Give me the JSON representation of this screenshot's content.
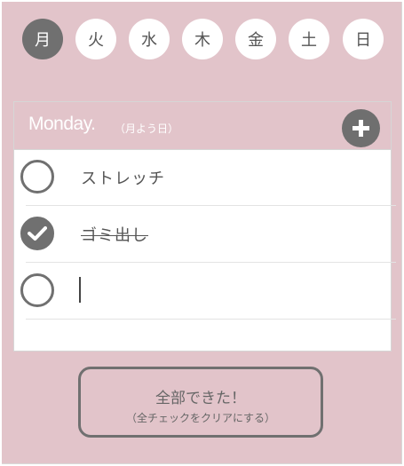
{
  "days": [
    "月",
    "火",
    "水",
    "木",
    "金",
    "土",
    "日"
  ],
  "active_day": "月",
  "card": {
    "title": "Monday.",
    "subtitle": "（月よう日）"
  },
  "tasks": [
    {
      "text": "ストレッチ",
      "done": false
    },
    {
      "text": "ゴミ出し",
      "done": true
    },
    {
      "text": "",
      "done": false,
      "editing": true
    }
  ],
  "clear_button": {
    "label": "全部できた！",
    "sublabel": "（全チェックをクリアにする）"
  },
  "colors": {
    "background": "#e2c4ca",
    "accent": "#707070",
    "card": "#ffffff"
  },
  "icons": {
    "add": "plus-icon",
    "check": "checkmark-icon"
  }
}
